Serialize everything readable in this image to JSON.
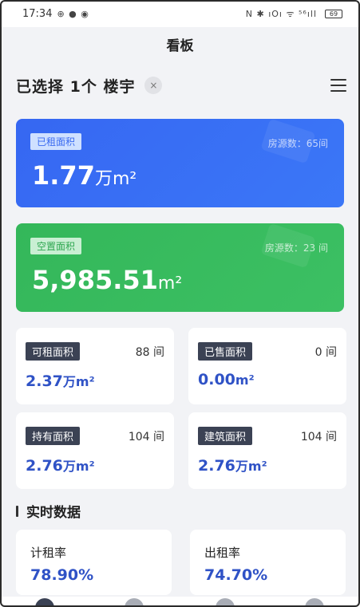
{
  "status_bar": {
    "time": "17:34",
    "left_icons": "⊕ ● ◉",
    "right_icons": "N ✱ ıOı ᯤ ⁵⁶ıll",
    "battery": "69"
  },
  "header": {
    "title": "看板"
  },
  "selection": {
    "text": "已选择 1个 楼宇",
    "clear_label": "×"
  },
  "rented_card": {
    "tag": "已租面积",
    "count_label": "房源数：65间",
    "value": "1.77",
    "unit": "万m²",
    "color": "#3667f2"
  },
  "vacant_card": {
    "tag": "空置面积",
    "count_label": "房源数：23 间",
    "value": "5,985.51",
    "unit": "m²",
    "color": "#34b75a"
  },
  "stats": [
    {
      "tag": "可租面积",
      "count": "88 间",
      "value": "2.37",
      "unit": "万m²"
    },
    {
      "tag": "已售面积",
      "count": "0 间",
      "value": "0.00",
      "unit": "m²"
    },
    {
      "tag": "持有面积",
      "count": "104 间",
      "value": "2.76",
      "unit": "万m²"
    },
    {
      "tag": "建筑面积",
      "count": "104 间",
      "value": "2.76",
      "unit": "万m²"
    }
  ],
  "realtime": {
    "title": "实时数据",
    "rates": [
      {
        "label": "计租率",
        "value": "78.90%"
      },
      {
        "label": "出租率",
        "value": "74.70%"
      }
    ]
  },
  "accent_color": "#2f52c6"
}
